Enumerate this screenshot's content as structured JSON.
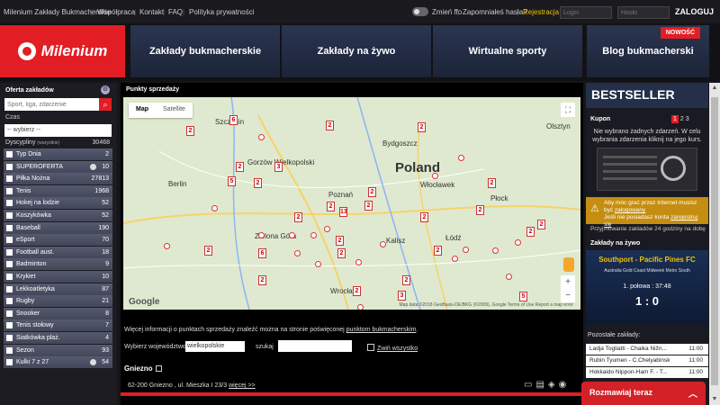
{
  "topbar": {
    "links": [
      "Milenium Zakłady Bukmacherskie",
      "Współpraca",
      "Kontakt",
      "FAQ",
      "Polityka prywatności"
    ],
    "toggle_label": "Zmień ffo",
    "forgot": "Zapomniałeś hasła?",
    "register": "Rejestracja",
    "login_placeholder": "Login",
    "password_placeholder": "Hasło",
    "login_button": "ZALOGUJ"
  },
  "header": {
    "logo": "Milenium",
    "nav": [
      "Zakłady bukmacherskie",
      "Zakłady na żywo",
      "Wirtualne sporty",
      "Blog bukmacherski"
    ],
    "new_badge": "NOWOŚĆ"
  },
  "sidebar": {
    "title": "Oferta zakładów",
    "search_placeholder": "Sport, liga, zdarzenie",
    "czas_label": "Czas",
    "select_value": "-- wybierz --",
    "disciplines_label": "Dyscypliny",
    "disciplines_sub": "(wszystkie)",
    "disciplines_count": "30468",
    "items": [
      {
        "label": "Typ Dnia",
        "count": "2",
        "ball": false
      },
      {
        "label": "SUPEROFERTA",
        "count": "10",
        "ball": true
      },
      {
        "label": "Piłka Nożna",
        "count": "27813",
        "ball": false
      },
      {
        "label": "Tenis",
        "count": "1968",
        "ball": false
      },
      {
        "label": "Hokej na lodzie",
        "count": "52",
        "ball": false
      },
      {
        "label": "Koszykówka",
        "count": "52",
        "ball": false
      },
      {
        "label": "Baseball",
        "count": "190",
        "ball": false
      },
      {
        "label": "eSport",
        "count": "70",
        "ball": false
      },
      {
        "label": "Football aust.",
        "count": "18",
        "ball": false
      },
      {
        "label": "Badminton",
        "count": "9",
        "ball": false
      },
      {
        "label": "Krykiet",
        "count": "10",
        "ball": false
      },
      {
        "label": "Lekkoatletyka",
        "count": "87",
        "ball": false
      },
      {
        "label": "Rugby",
        "count": "21",
        "ball": false
      },
      {
        "label": "Snooker",
        "count": "8",
        "ball": false
      },
      {
        "label": "Tenis stołowy",
        "count": "7",
        "ball": false
      },
      {
        "label": "Siatkówka plaż.",
        "count": "4",
        "ball": false
      },
      {
        "label": "Sezon",
        "count": "93",
        "ball": false
      },
      {
        "label": "Kulki 7 z 27",
        "count": "54",
        "ball": true
      }
    ]
  },
  "main": {
    "title": "Punkty sprzedaży",
    "map_tab": "Map",
    "satellite_tab": "Satellite",
    "country": "Poland",
    "cities": [
      "Szczecin",
      "Bydgoszcz",
      "Gorzów Wielkopolski",
      "Berlin",
      "Poznań",
      "Włocławek",
      "Płock",
      "Kalisz",
      "Łódź",
      "Zielona Góra",
      "Wrocław",
      "Olsztyn"
    ],
    "google": "Google",
    "map_footer": "Map data ©2018 GeoBasis-DE/BKG (©2009), Google   Terms of Use   Report a map error",
    "info_text": "Więcej informacji o punktach sprzedaży znaleźć można na stronie poświęconej ",
    "info_link": "punktom bukmacherskim",
    "info_end": ".",
    "wyb_label": "Wybierz województwo",
    "wyb_value": "wielkopolskie",
    "szukaj_label": "szukaj",
    "zwin": "Zwiń wszystko",
    "group": "Gniezno",
    "address": "62-200 Gniezno , ul. Mieszka I 23/3 ",
    "address_link": "więcej >>"
  },
  "right": {
    "bestseller": "BESTSELLER",
    "kupon_title": "Kupon",
    "kupon_tabs": [
      "1",
      "2",
      "3"
    ],
    "kupon_msg": "Nie wybrano żadnych zdarzeń. W celu wybrania zdarzenia kliknij na jego kurs.",
    "warn_line1": "Aby móc grać przez Internet musisz być ",
    "warn_link1": "zalogowany",
    "warn_line2": "Jeśli nie posiadasz konta ",
    "warn_link2": "zarejestruj się",
    "przyj": "Przyjmowanie zakładów 24 godziny na dobę",
    "live_head": "Zakłady na żywo",
    "live_teams": "Southport - Pacific Pines FC",
    "live_league": "Australia Gold Coast Midweek Metro South",
    "live_period": "1. połowa : 37:48",
    "live_score": "1 : 0",
    "others_head": "Pozostałe zakłady:",
    "events": [
      {
        "name": "Ladja Togliatti - Chaika Nižn...",
        "time": "11:00"
      },
      {
        "name": "Rubin Tyumen - C.Chelyabinsk",
        "time": "11:00"
      },
      {
        "name": "Hokkaido Nippon-Ham F. - T...",
        "time": "11:00"
      }
    ]
  },
  "chat": {
    "label": "Rozmawiaj teraz"
  }
}
